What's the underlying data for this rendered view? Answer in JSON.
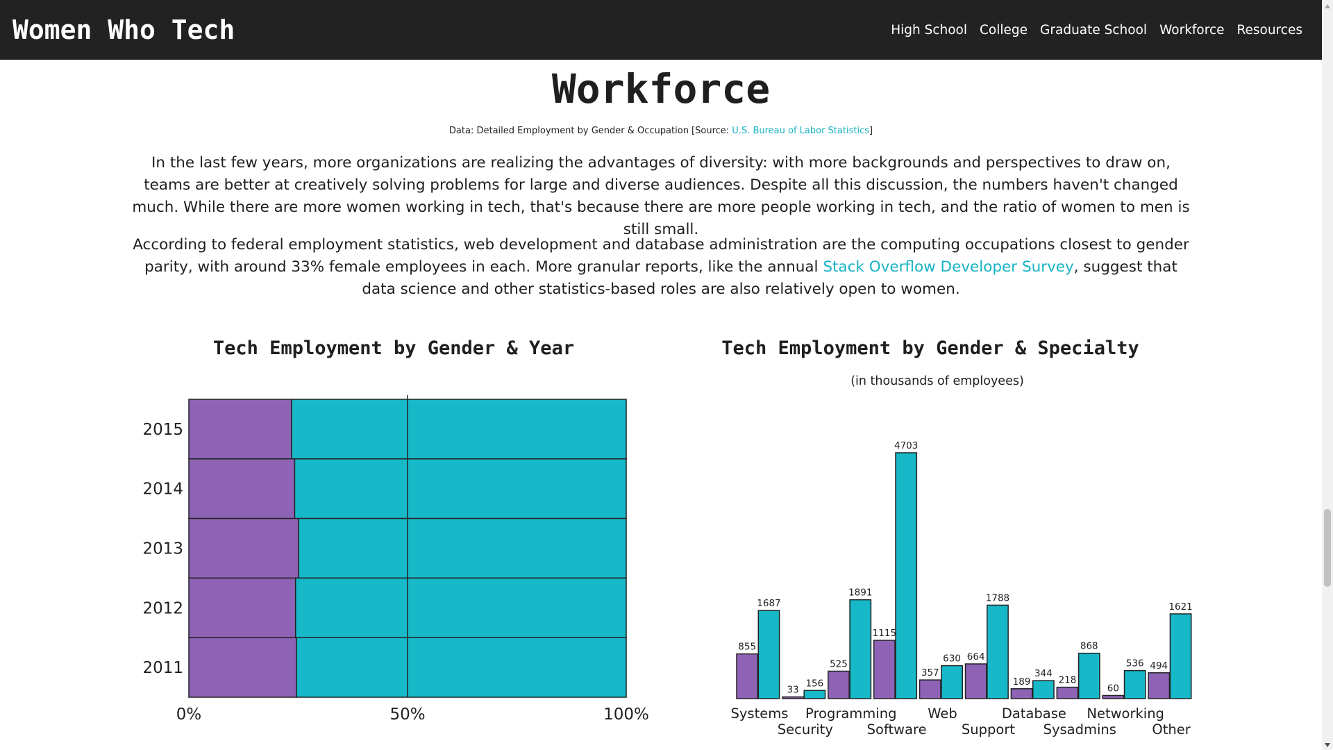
{
  "nav": {
    "brand": "Women Who Tech",
    "items": [
      "High School",
      "College",
      "Graduate School",
      "Workforce",
      "Resources"
    ]
  },
  "page": {
    "title": "Workforce",
    "source_prefix": "Data: Detailed Employment by Gender & Occupation [Source: ",
    "source_link": "U.S. Bureau of Labor Statistics",
    "source_suffix": "]",
    "para1": "In the last few years, more organizations are realizing the advantages of diversity: with more backgrounds and perspectives to draw on, teams are better at creatively solving problems for large and diverse audiences. Despite all this discussion, the numbers haven't changed much. While there are more women working in tech, that's because there are more people working in tech, and the ratio of women to men is still small.",
    "para2_prefix": "According to federal employment statistics, web development and database administration are the computing occupations closest to gender parity, with around 33% female employees in each. More granular reports, like the annual ",
    "para2_link": "Stack Overflow Developer Survey",
    "para2_suffix": ", suggest that data science and other statistics-based roles are also relatively open to women."
  },
  "colors": {
    "women": "#8e63b5",
    "men": "#17b8c8",
    "link": "#17b3c4"
  },
  "chart_data": [
    {
      "type": "bar",
      "orientation": "horizontal",
      "stacked": "percent",
      "title": "Tech Employment by Gender & Year",
      "categories": [
        "2015",
        "2014",
        "2013",
        "2012",
        "2011"
      ],
      "series": [
        {
          "values": [
            23.5,
            24.2,
            25.1,
            24.4,
            24.6
          ]
        },
        {
          "values": [
            76.5,
            75.8,
            74.9,
            75.6,
            75.4
          ]
        }
      ],
      "xlim": [
        0,
        100
      ],
      "xticks": [
        "0%",
        "50%",
        "100%"
      ]
    },
    {
      "type": "bar",
      "title": "Tech Employment by Gender & Specialty",
      "subtitle": "(in thousands of employees)",
      "categories": [
        "Systems",
        "Security",
        "Programming",
        "Software",
        "Web",
        "Support",
        "Database",
        "Sysadmins",
        "Networking",
        "Other"
      ],
      "series": [
        {
          "values": [
            855,
            33,
            525,
            1115,
            357,
            664,
            189,
            218,
            60,
            494
          ]
        },
        {
          "values": [
            1687,
            156,
            1891,
            4703,
            630,
            1788,
            344,
            868,
            536,
            1621
          ]
        }
      ],
      "ylim": [
        0,
        4703
      ]
    }
  ]
}
